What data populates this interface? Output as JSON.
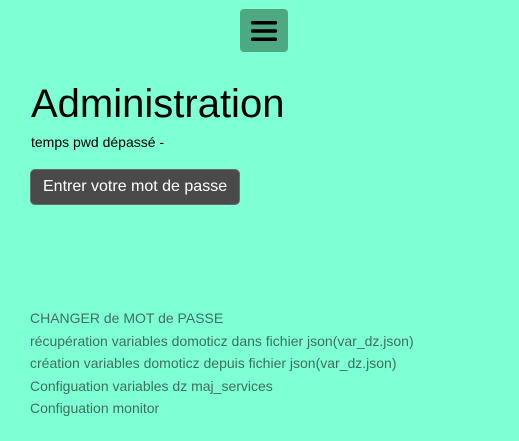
{
  "header": {
    "menu_icon": "hamburger-menu-icon"
  },
  "main": {
    "title": "Administration",
    "status": "temps pwd dépassé -",
    "password_button_label": "Entrer votre mot de passe"
  },
  "links": [
    {
      "label": "CHANGER de MOT de PASSE"
    },
    {
      "label": "récupération variables domoticz dans fichier json(var_dz.json)"
    },
    {
      "label": "création variables domoticz depuis fichier json(var_dz.json)"
    },
    {
      "label": "Configuation variables dz maj_services"
    },
    {
      "label": "Configuation monitor"
    }
  ],
  "colors": {
    "background": "#7fffd4",
    "menu_button": "#4ea882",
    "password_button": "#4a4a4a",
    "link_text": "#3f6f60"
  }
}
